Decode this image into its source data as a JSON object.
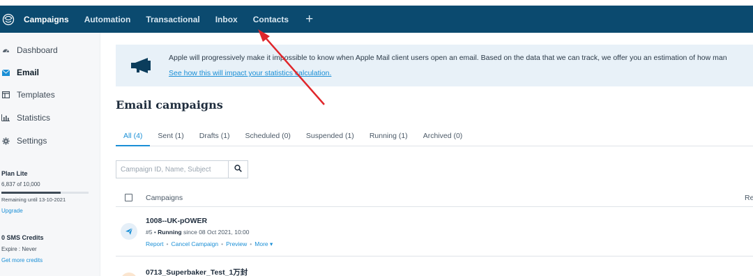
{
  "nav": {
    "items": [
      {
        "label": "Campaigns",
        "active": true
      },
      {
        "label": "Automation"
      },
      {
        "label": "Transactional"
      },
      {
        "label": "Inbox"
      },
      {
        "label": "Contacts"
      }
    ],
    "plus": "+"
  },
  "sidebar": {
    "items": [
      {
        "label": "Dashboard",
        "icon": "dashboard-icon"
      },
      {
        "label": "Email",
        "icon": "envelope-icon",
        "active": true
      },
      {
        "label": "Templates",
        "icon": "templates-icon"
      },
      {
        "label": "Statistics",
        "icon": "statistics-icon"
      },
      {
        "label": "Settings",
        "icon": "gear-icon"
      }
    ],
    "plan": {
      "title": "Plan Lite",
      "count": "6,837 of 10,000",
      "usage_fraction": 0.6837,
      "remaining": "Remaining until 13-10-2021",
      "upgrade": "Upgrade"
    },
    "sms": {
      "title": "0 SMS Credits",
      "expire": "Expire : Never",
      "link": "Get more credits"
    }
  },
  "banner": {
    "text_before": "Apple will progressively make it impossible to know when Apple Mail client users open an email.",
    "bold": "",
    "text_after": " Based on the data that we can track, we offer you an estimation of how man",
    "link": "See how this will impact your statistics calculation."
  },
  "page": {
    "title": "Email campaigns"
  },
  "tabs": [
    {
      "label": "All (4)",
      "active": true
    },
    {
      "label": "Sent (1)"
    },
    {
      "label": "Drafts (1)"
    },
    {
      "label": "Scheduled (0)"
    },
    {
      "label": "Suspended (1)"
    },
    {
      "label": "Running (1)"
    },
    {
      "label": "Archived (0)"
    }
  ],
  "search": {
    "placeholder": "Campaign ID, Name, Subject"
  },
  "table": {
    "header_campaigns": "Campaigns",
    "header_right": "Re",
    "rows": [
      {
        "name": "1008--UK-pOWER",
        "meta_prefix": "#5 • ",
        "status": "Running",
        "meta_suffix": " since 08 Oct 2021, 10:00",
        "actions": [
          "Report",
          "Cancel Campaign",
          "Preview",
          "More ▾"
        ]
      },
      {
        "name": "0713_Superbaker_Test_1万封"
      }
    ]
  },
  "colors": {
    "nav_bg": "#0b4a6f",
    "accent": "#1a8fd6",
    "annotation": "#e0262b"
  }
}
